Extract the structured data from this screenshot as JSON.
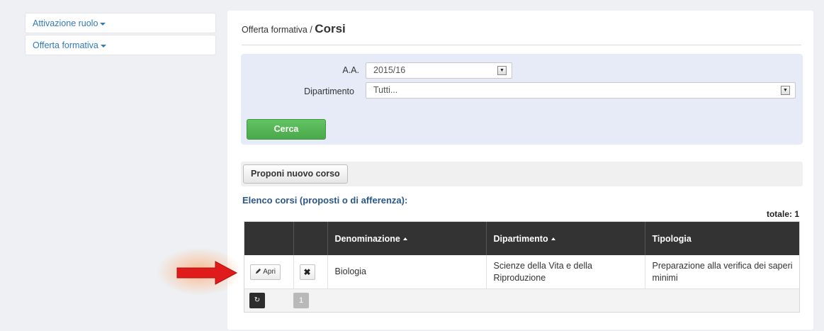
{
  "sidebar": {
    "items": [
      {
        "label": "Attivazione ruolo"
      },
      {
        "label": "Offerta formativa"
      }
    ]
  },
  "breadcrumb": {
    "parent": "Offerta formativa /",
    "current": "Corsi"
  },
  "filters": {
    "aa_label": "A.A.",
    "aa_value": "2015/16",
    "dipartimento_label": "Dipartimento",
    "dipartimento_value": "Tutti...",
    "search_button": "Cerca"
  },
  "actions": {
    "propose_button": "Proponi nuovo corso"
  },
  "list": {
    "title": "Elenco corsi (proposti o di afferenza):",
    "total": "totale: 1",
    "columns": [
      "",
      "",
      "Denominazione",
      "Dipartimento",
      "Tipologia"
    ],
    "rows": [
      {
        "open_label": "Apri",
        "denominazione": "Biologia",
        "dipartimento": "Scienze della Vita e della Riproduzione",
        "tipologia": "Preparazione alla verifica dei saperi minimi"
      }
    ],
    "current_page": "1"
  },
  "icons": {
    "caret": "caret-down-icon",
    "edit": "pencil-icon",
    "delete": "times-icon",
    "refresh": "refresh-icon",
    "annotation": "red-arrow-icon"
  },
  "colors": {
    "link": "#337ab7",
    "search_button": "#5cb85c",
    "table_header": "#333333",
    "filter_bg": "#e6ebf7",
    "annotation": "#e01b1b"
  }
}
